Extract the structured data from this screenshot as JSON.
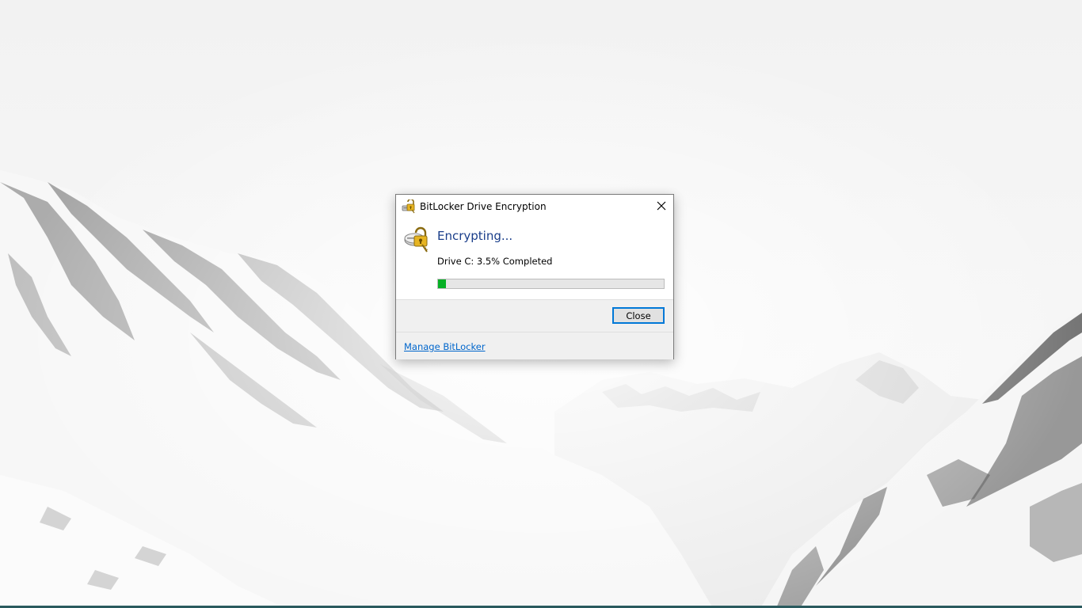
{
  "dialog": {
    "title": "BitLocker Drive Encryption",
    "heading": "Encrypting...",
    "status": "Drive C: 3.5% Completed",
    "progress_percent": 3.5,
    "close_button": "Close",
    "manage_link": "Manage BitLocker",
    "title_icon": "bitlocker-drive-icon",
    "close_icon": "close-icon",
    "main_icon": "bitlocker-lock-icon"
  },
  "colors": {
    "heading": "#1a3e8a",
    "progress_fill": "#06b025",
    "button_focus": "#0078d7",
    "link": "#0066cc"
  }
}
